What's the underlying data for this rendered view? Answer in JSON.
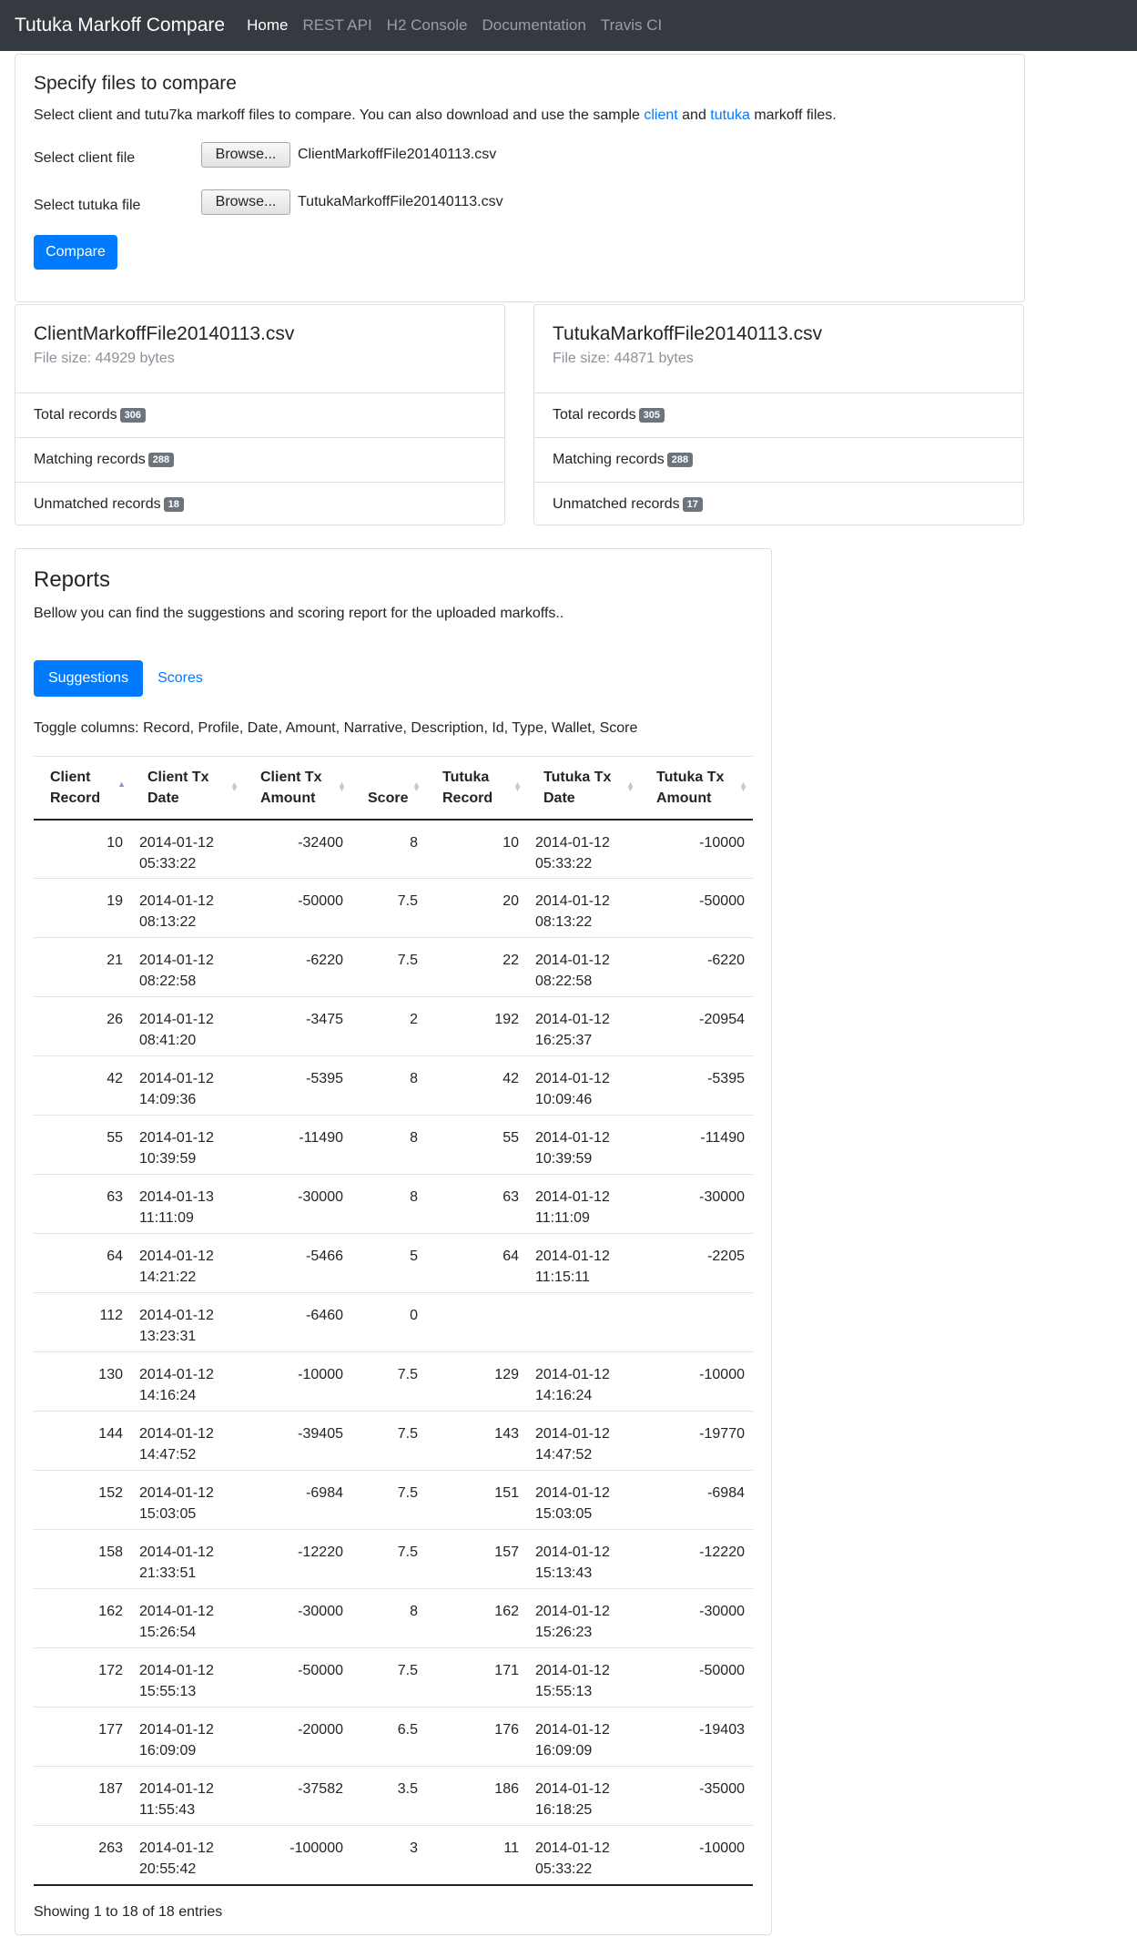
{
  "navbar": {
    "brand": "Tutuka Markoff Compare",
    "links": [
      "Home",
      "REST API",
      "H2 Console",
      "Documentation",
      "Travis CI"
    ]
  },
  "upload": {
    "title": "Specify files to compare",
    "desc_pre": "Select client and tutu7ka markoff files to compare. You can also download and use the sample ",
    "link_client": "client",
    "desc_and": " and ",
    "link_tutuka": "tutuka",
    "desc_post": " markoff files.",
    "client_label": "Select client file",
    "tutuka_label": "Select tutuka file",
    "browse": "Browse...",
    "client_file": "ClientMarkoffFile20140113.csv",
    "tutuka_file": "TutukaMarkoffFile20140113.csv",
    "compare": "Compare"
  },
  "client_card": {
    "name": "ClientMarkoffFile20140113.csv",
    "size": "File size: 44929 bytes",
    "total_label": "Total records",
    "total": "306",
    "matching_label": "Matching records",
    "matching": "288",
    "unmatched_label": "Unmatched records",
    "unmatched": "18"
  },
  "tutuka_card": {
    "name": "TutukaMarkoffFile20140113.csv",
    "size": "File size: 44871 bytes",
    "total_label": "Total records",
    "total": "305",
    "matching_label": "Matching records",
    "matching": "288",
    "unmatched_label": "Unmatched records",
    "unmatched": "17"
  },
  "reports": {
    "title": "Reports",
    "desc": "Bellow you can find the suggestions and scoring report for the uploaded markoffs..",
    "tabs": [
      "Suggestions",
      "Scores"
    ],
    "toggle": "Toggle columns: Record, Profile, Date, Amount, Narrative, Description, Id, Type, Wallet, Score",
    "headers": [
      [
        "Client",
        "Record"
      ],
      [
        "Client Tx",
        "Date"
      ],
      [
        "Client Tx",
        "Amount"
      ],
      [
        "",
        "Score"
      ],
      [
        "Tutuka",
        "Record"
      ],
      [
        "Tutuka Tx",
        "Date"
      ],
      [
        "Tutuka Tx",
        "Amount"
      ]
    ],
    "rows": [
      [
        "10",
        "2014-01-12",
        "05:33:22",
        "-32400",
        "8",
        "10",
        "2014-01-12",
        "05:33:22",
        "-10000"
      ],
      [
        "19",
        "2014-01-12",
        "08:13:22",
        "-50000",
        "7.5",
        "20",
        "2014-01-12",
        "08:13:22",
        "-50000"
      ],
      [
        "21",
        "2014-01-12",
        "08:22:58",
        "-6220",
        "7.5",
        "22",
        "2014-01-12",
        "08:22:58",
        "-6220"
      ],
      [
        "26",
        "2014-01-12",
        "08:41:20",
        "-3475",
        "2",
        "192",
        "2014-01-12",
        "16:25:37",
        "-20954"
      ],
      [
        "42",
        "2014-01-12",
        "14:09:36",
        "-5395",
        "8",
        "42",
        "2014-01-12",
        "10:09:46",
        "-5395"
      ],
      [
        "55",
        "2014-01-12",
        "10:39:59",
        "-11490",
        "8",
        "55",
        "2014-01-12",
        "10:39:59",
        "-11490"
      ],
      [
        "63",
        "2014-01-13",
        "11:11:09",
        "-30000",
        "8",
        "63",
        "2014-01-12",
        "11:11:09",
        "-30000"
      ],
      [
        "64",
        "2014-01-12",
        "14:21:22",
        "-5466",
        "5",
        "64",
        "2014-01-12",
        "11:15:11",
        "-2205"
      ],
      [
        "112",
        "2014-01-12",
        "13:23:31",
        "-6460",
        "0",
        "",
        "",
        "",
        ""
      ],
      [
        "130",
        "2014-01-12",
        "14:16:24",
        "-10000",
        "7.5",
        "129",
        "2014-01-12",
        "14:16:24",
        "-10000"
      ],
      [
        "144",
        "2014-01-12",
        "14:47:52",
        "-39405",
        "7.5",
        "143",
        "2014-01-12",
        "14:47:52",
        "-19770"
      ],
      [
        "152",
        "2014-01-12",
        "15:03:05",
        "-6984",
        "7.5",
        "151",
        "2014-01-12",
        "15:03:05",
        "-6984"
      ],
      [
        "158",
        "2014-01-12",
        "21:33:51",
        "-12220",
        "7.5",
        "157",
        "2014-01-12",
        "15:13:43",
        "-12220"
      ],
      [
        "162",
        "2014-01-12",
        "15:26:54",
        "-30000",
        "8",
        "162",
        "2014-01-12",
        "15:26:23",
        "-30000"
      ],
      [
        "172",
        "2014-01-12",
        "15:55:13",
        "-50000",
        "7.5",
        "171",
        "2014-01-12",
        "15:55:13",
        "-50000"
      ],
      [
        "177",
        "2014-01-12",
        "16:09:09",
        "-20000",
        "6.5",
        "176",
        "2014-01-12",
        "16:09:09",
        "-19403"
      ],
      [
        "187",
        "2014-01-12",
        "11:55:43",
        "-37582",
        "3.5",
        "186",
        "2014-01-12",
        "16:18:25",
        "-35000"
      ],
      [
        "263",
        "2014-01-12",
        "20:55:42",
        "-100000",
        "3",
        "11",
        "2014-01-12",
        "05:33:22",
        "-10000"
      ]
    ],
    "info": "Showing 1 to 18 of 18 entries"
  }
}
